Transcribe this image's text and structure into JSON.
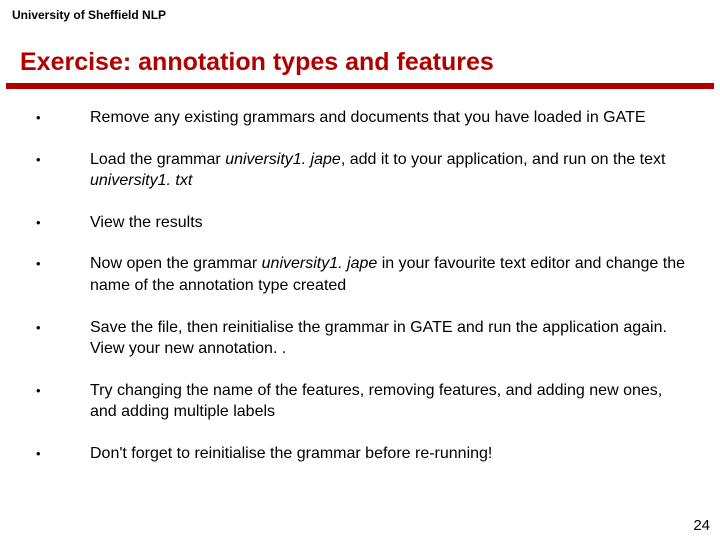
{
  "header": "University of Sheffield NLP",
  "title": "Exercise: annotation types and features",
  "bullets": {
    "b0": "Remove any existing grammars and documents that you have loaded in GATE",
    "b1a": "Load the grammar ",
    "b1i1": "university1. jape",
    "b1b": ", add it to your application, and run on the text ",
    "b1i2": "university1. txt",
    "b2": "View the results",
    "b3a": "Now open the grammar ",
    "b3i": "university1. jape",
    "b3b": " in your favourite text editor and change the name of the annotation type created",
    "b4": "Save the file, then reinitialise the grammar in GATE and run the application again. View your new annotation. .",
    "b5": "Try changing the name of the features, removing features, and adding new ones, and adding multiple labels",
    "b6": "Don't forget to reinitialise the grammar before re-running!"
  },
  "dot": "•",
  "pagenum": "24"
}
